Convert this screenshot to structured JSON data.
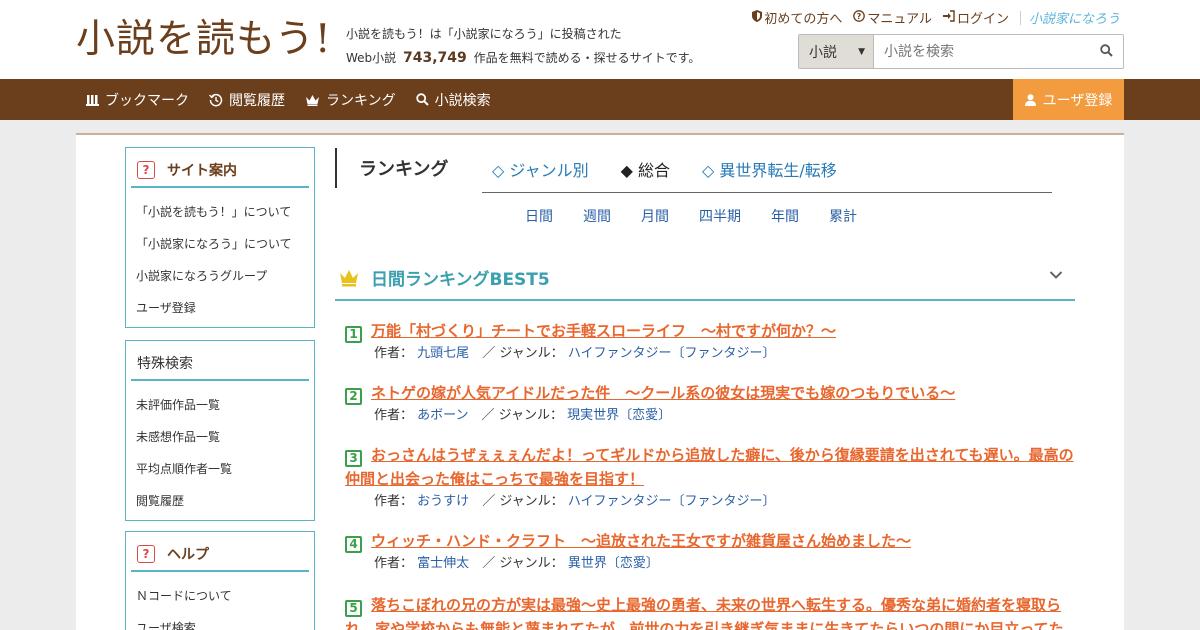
{
  "site": {
    "logo": "小説を読もう!",
    "tagline_1": "小説を読もう！は「小説家になろう」に投稿された",
    "tagline_prefix": "Web小説",
    "tagline_count": "743,749",
    "tagline_suffix": "作品を無料で読める・探せるサイトです。"
  },
  "toplinks": {
    "first_time": "初めての方へ",
    "manual": "マニュアル",
    "login": "ログイン",
    "narou": "小説家になろう"
  },
  "search": {
    "category": "小説",
    "placeholder": "小説を検索"
  },
  "nav": {
    "bookmark": "ブックマーク",
    "history": "閲覧履歴",
    "ranking": "ランキング",
    "search": "小説検索",
    "register": "ユーザ登録"
  },
  "sidebar": {
    "guide_title": "サイト案内",
    "guide_items": [
      "「小説を読もう！」について",
      "「小説家になろう」について",
      "小説家になろうグループ",
      "ユーザ登録"
    ],
    "special_title": "特殊検索",
    "special_items": [
      "未評価作品一覧",
      "未感想作品一覧",
      "平均点順作者一覧",
      "閲覧履歴"
    ],
    "help_title": "ヘルプ",
    "help_items": [
      "Ｎコードについて",
      "ユーザ検索"
    ]
  },
  "ranking": {
    "title": "ランキング",
    "tabs": [
      "◇ ジャンル別",
      "◆ 総合",
      "◇ 異世界転生/転移"
    ],
    "periods": [
      "日間",
      "週間",
      "月間",
      "四半期",
      "年間",
      "累計"
    ],
    "best_title": "日間ランキングBEST5",
    "author_label": "作者：",
    "genre_label": "／ ジャンル：",
    "entries": [
      {
        "rank": "1",
        "title": "万能「村づくり」チートでお手軽スローライフ　～村ですが何か？～",
        "author": "九頭七尾",
        "genre": "ハイファンタジー〔ファンタジー〕"
      },
      {
        "rank": "2",
        "title": "ネトゲの嫁が人気アイドルだった件　～クール系の彼女は現実でも嫁のつもりでいる～",
        "author": "あボーン",
        "genre": "現実世界〔恋愛〕"
      },
      {
        "rank": "3",
        "title": "おっさんはうぜぇぇぇんだよ！ってギルドから追放した癖に、後から復縁要請を出されても遅い。最高の仲間と出会った俺はこっちで最強を目指す！",
        "author": "おうすけ",
        "genre": "ハイファンタジー〔ファンタジー〕"
      },
      {
        "rank": "4",
        "title": "ウィッチ・ハンド・クラフト　～追放された王女ですが雑貨屋さん始めました～",
        "author": "富士伸太",
        "genre": "異世界〔恋愛〕"
      },
      {
        "rank": "5",
        "title": "落ちこぼれの兄の方が実は最強〜史上最強の勇者、未来の世界へ転生する。優秀な弟に婚約者を寝取られ、家や学校からも無能と蔑まれてたが、前世の力を引き継ぎ気ままに生きてたらいつの間にか目立ってた",
        "author": "",
        "genre": ""
      }
    ]
  }
}
